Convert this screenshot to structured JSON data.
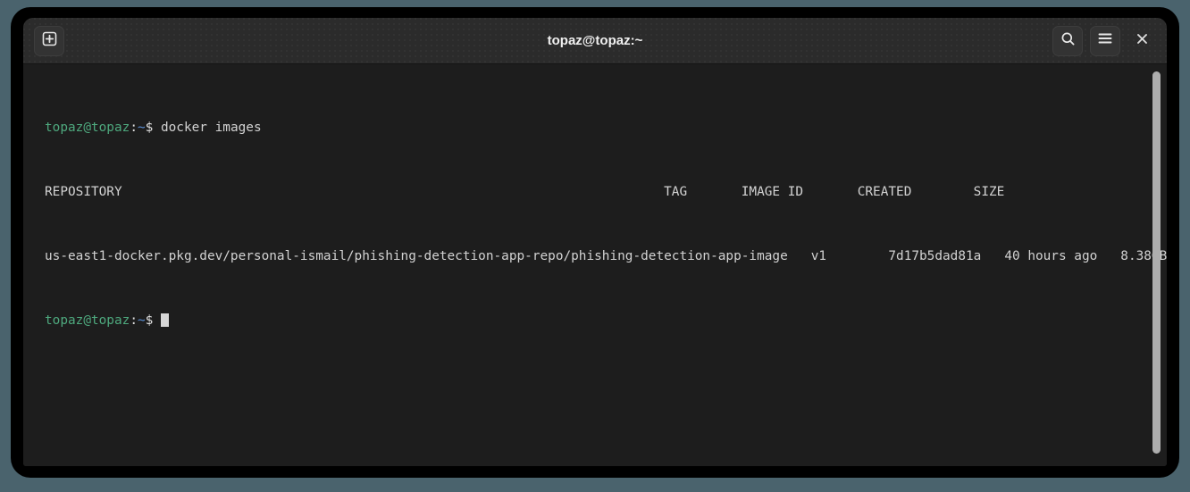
{
  "window": {
    "title": "topaz@topaz:~",
    "accent_color": "#4ea97e",
    "titlebar_bg": "#2b2b2b",
    "terminal_bg": "#1d1d1d",
    "desktop_bg": "#4a636d"
  },
  "titlebar": {
    "new_tab_label": "+",
    "search_label": "Search",
    "menu_label": "Menu",
    "close_label": "×"
  },
  "terminal": {
    "prompt": {
      "user_host": "topaz@topaz",
      "colon": ":",
      "path": "~",
      "sigil": "$ "
    },
    "command": "docker images",
    "header": {
      "repository": "REPOSITORY",
      "tag": "TAG",
      "image_id": "IMAGE ID",
      "created": "CREATED",
      "size": "SIZE"
    },
    "rows": [
      {
        "repository": "us-east1-docker.pkg.dev/personal-ismail/phishing-detection-app-repo/phishing-detection-app-image",
        "tag": "v1",
        "image_id": "7d17b5dad81a",
        "created": "40 hours ago",
        "size": "8.38GB"
      }
    ],
    "header_line": "REPOSITORY                                                                      TAG       IMAGE ID       CREATED        SIZE",
    "row_line": "us-east1-docker.pkg.dev/personal-ismail/phishing-detection-app-repo/phishing-detection-app-image   v1        7d17b5dad81a   40 hours ago   8.38GB"
  },
  "scrollbar": {
    "position": "top"
  }
}
